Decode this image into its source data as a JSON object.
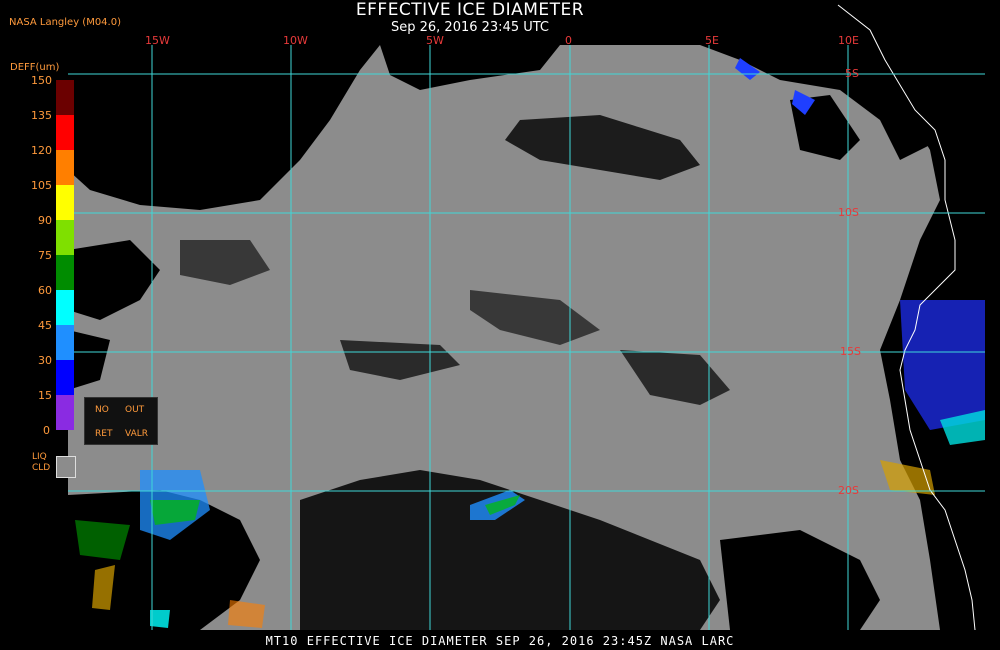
{
  "header": {
    "title": "EFFECTIVE ICE DIAMETER",
    "datetime": "Sep 26, 2016 23:45 UTC",
    "org": "NASA Langley (M04.0)"
  },
  "map": {
    "lon_labels": [
      "15W",
      "10W",
      "5W",
      "0",
      "5E",
      "10E"
    ],
    "lat_labels": [
      "5S",
      "10S",
      "15S",
      "20S"
    ],
    "colors": {
      "ocean_cloud": "#8c8c8c",
      "land": "#000000",
      "grid": "#3fd8d8",
      "label": "#e83a3a",
      "coast": "#ffffff"
    }
  },
  "legend": {
    "unit": "DEFF(um)",
    "ticks": [
      "150",
      "135",
      "120",
      "105",
      "90",
      "75",
      "60",
      "45",
      "30",
      "15",
      "0"
    ],
    "colors": [
      "#6b0000",
      "#ff0000",
      "#ff7f00",
      "#ffff00",
      "#7fe000",
      "#008c00",
      "#00ffff",
      "#1f8fff",
      "#0000ff",
      "#8a2be2"
    ],
    "panel": {
      "no": "NO",
      "out": "OUT",
      "ret": "RET",
      "valr": "VALR"
    },
    "liq_label": [
      "LIQ",
      "CLD"
    ]
  },
  "footer": {
    "text": "MT10  EFFECTIVE ICE DIAMETER  SEP 26, 2016 23:45Z  NASA LARC"
  }
}
